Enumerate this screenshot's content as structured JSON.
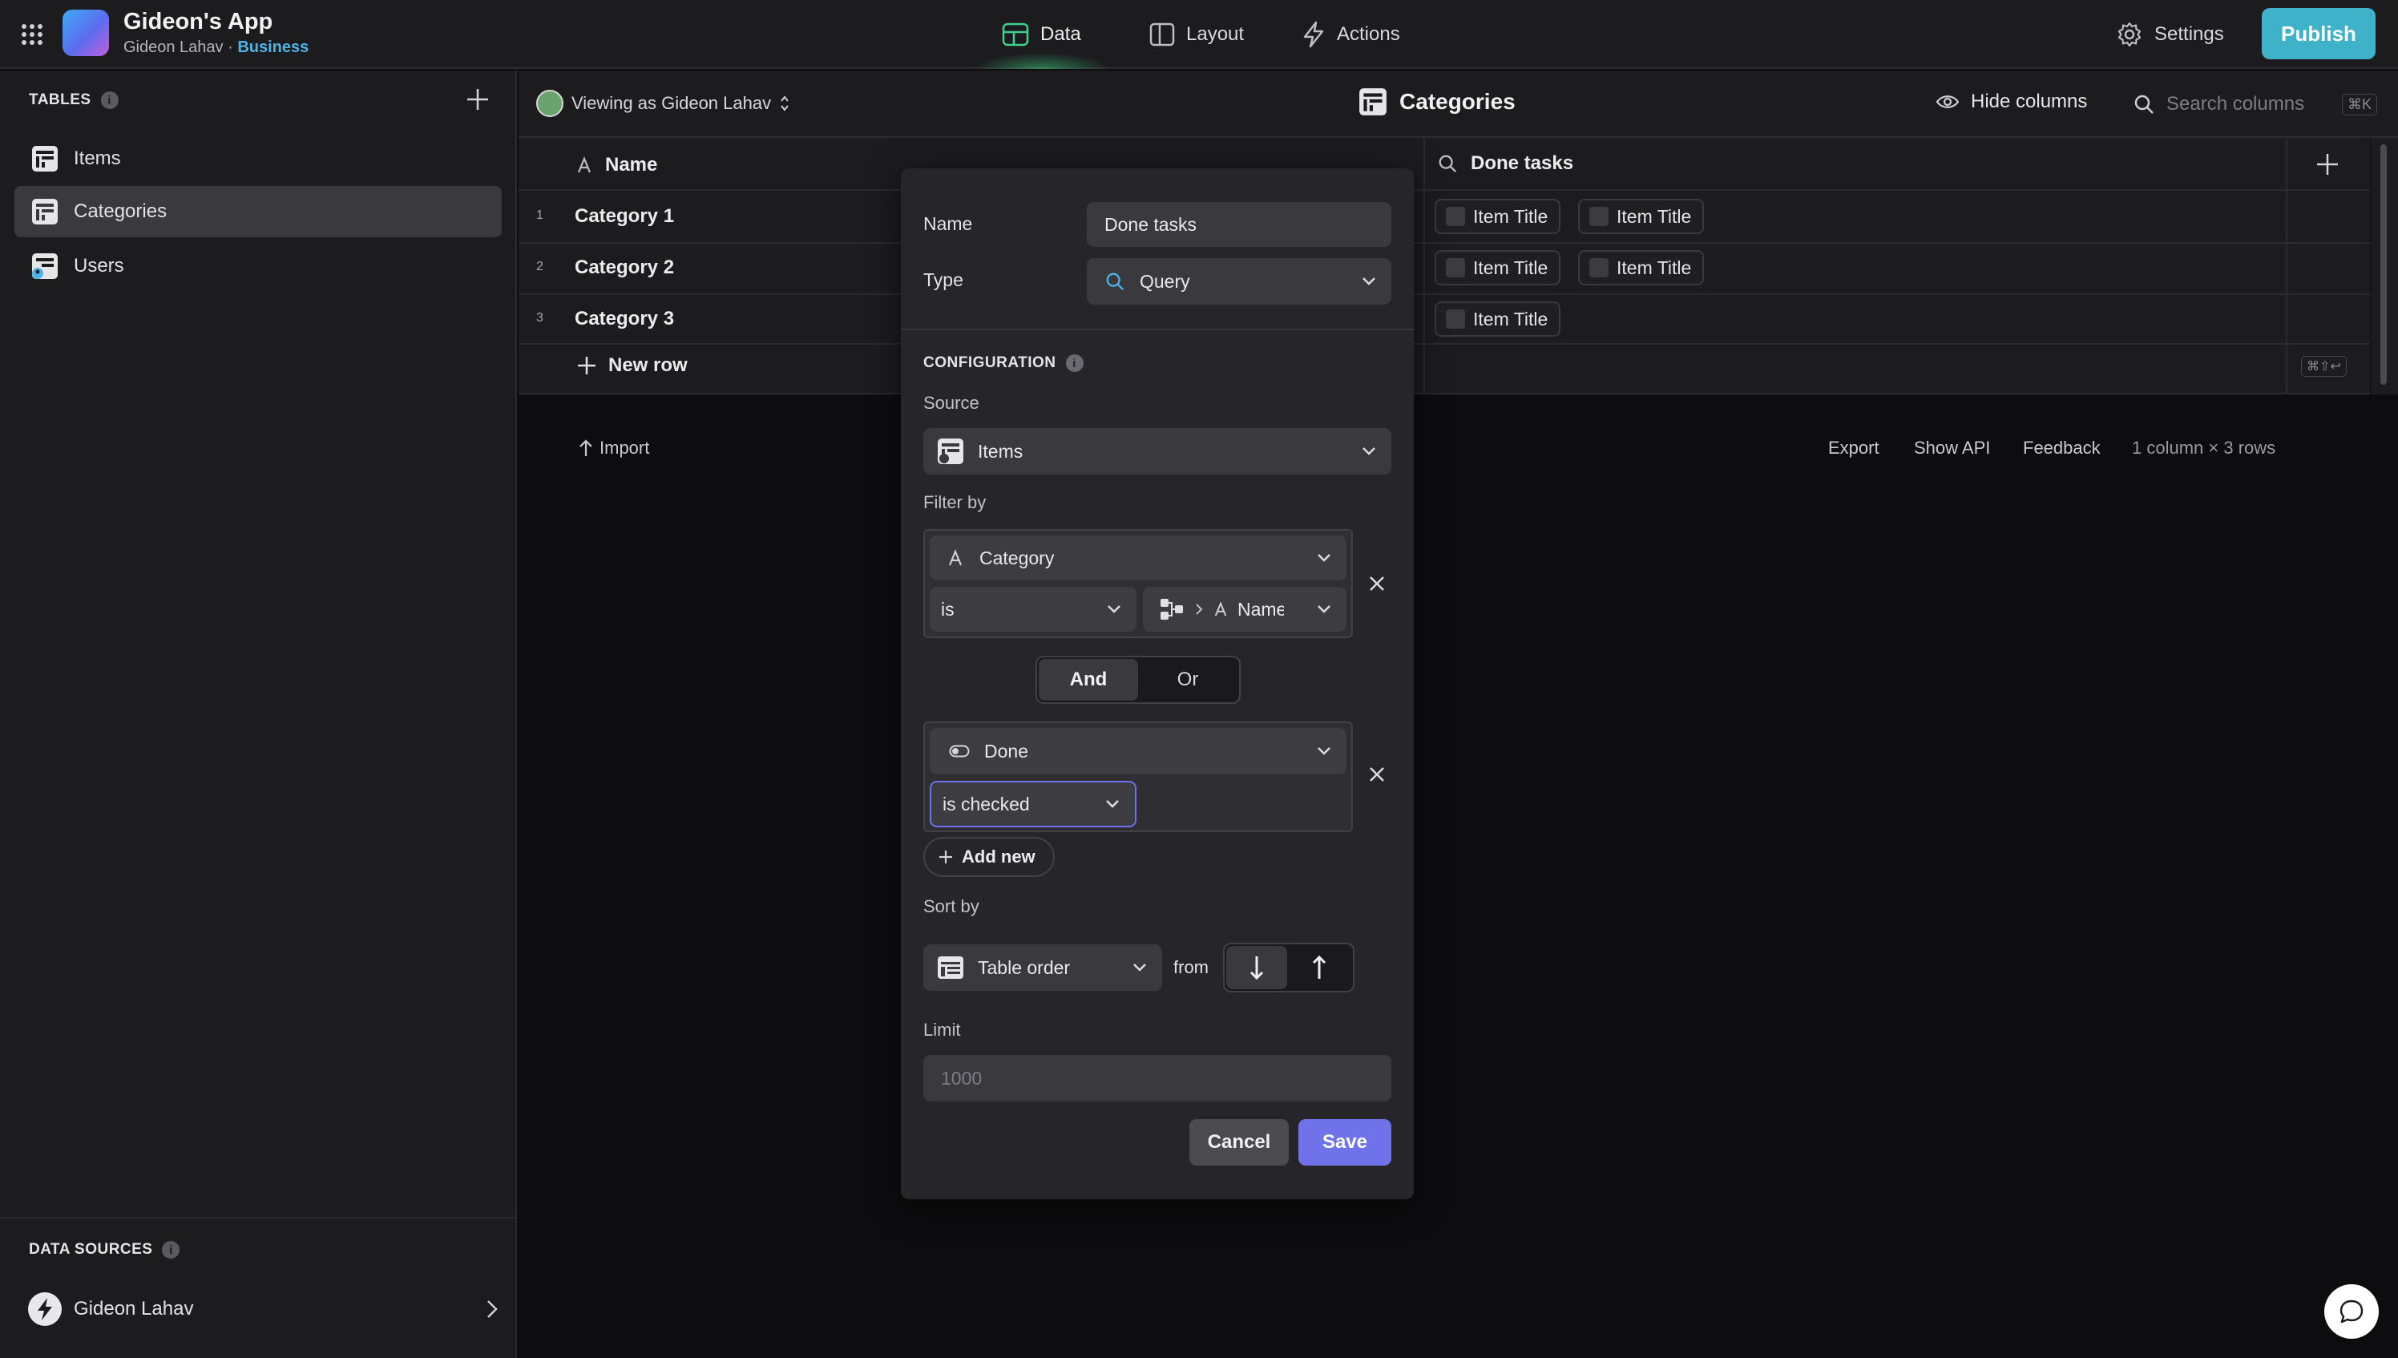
{
  "app": {
    "title": "Gideon's App",
    "owner": "Gideon Lahav",
    "separator": "·",
    "plan": "Business"
  },
  "nav": {
    "tabs": [
      {
        "label": "Data"
      },
      {
        "label": "Layout"
      },
      {
        "label": "Actions"
      }
    ],
    "settings": "Settings",
    "publish": "Publish"
  },
  "sidebar": {
    "tables_title": "TABLES",
    "tables": [
      {
        "label": "Items"
      },
      {
        "label": "Categories"
      },
      {
        "label": "Users"
      }
    ],
    "data_sources_title": "DATA SOURCES",
    "data_source": "Gideon Lahav"
  },
  "viewbar": {
    "viewing_as": "Viewing as Gideon Lahav",
    "table_title": "Categories",
    "hide_columns": "Hide columns",
    "search_placeholder": "Search columns",
    "shortcut": "⌘K"
  },
  "grid": {
    "columns": [
      {
        "label": "Name"
      },
      {
        "label": "Done tasks"
      }
    ],
    "rows": [
      {
        "num": "1",
        "name": "Category 1",
        "chips": [
          "Item Title",
          "Item Title"
        ]
      },
      {
        "num": "2",
        "name": "Category 2",
        "chips": [
          "Item Title",
          "Item Title"
        ]
      },
      {
        "num": "3",
        "name": "Category 3",
        "chips": [
          "Item Title"
        ]
      }
    ],
    "new_row": "New row",
    "shortcut_hint": "⌘⇧↩"
  },
  "footer": {
    "import": "Import",
    "export": "Export",
    "show_api": "Show API",
    "feedback": "Feedback",
    "summary": "1 column × 3 rows"
  },
  "modal": {
    "name_label": "Name",
    "name_value": "Done tasks",
    "type_label": "Type",
    "type_value": "Query",
    "configuration_title": "CONFIGURATION",
    "source_label": "Source",
    "source_value": "Items",
    "filter_label": "Filter by",
    "filter1": {
      "column": "Category",
      "operator": "is",
      "value": "Name"
    },
    "logic": {
      "and": "And",
      "or": "Or",
      "selected": "And"
    },
    "filter2": {
      "column": "Done",
      "operator": "is checked"
    },
    "add_new": "Add new",
    "sort_label": "Sort by",
    "sort_value": "Table order",
    "from_label": "from",
    "limit_label": "Limit",
    "limit_placeholder": "1000",
    "cancel": "Cancel",
    "save": "Save"
  },
  "colors": {
    "accent_publish": "#3fb1c9",
    "accent_save": "#6f72e8",
    "plan": "#4fb3e8",
    "background": "#0d0d0f",
    "panel": "#1c1c1f"
  }
}
